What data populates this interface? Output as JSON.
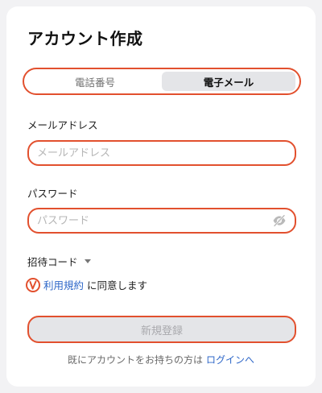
{
  "title": "アカウント作成",
  "tabs": [
    {
      "label": "電話番号",
      "active": false
    },
    {
      "label": "電子メール",
      "active": true
    }
  ],
  "email": {
    "label": "メールアドレス",
    "placeholder": "メールアドレス",
    "value": ""
  },
  "password": {
    "label": "パスワード",
    "placeholder": "パスワード",
    "value": "",
    "toggle_icon": "eye-off-icon"
  },
  "invite": {
    "label": "招待コード",
    "icon": "caret-down-icon"
  },
  "agreement": {
    "checked": false,
    "terms_link": "利用規約",
    "text": "に同意します"
  },
  "register_button": "新規登録",
  "footer": {
    "text": "既にアカウントをお持ちの方は",
    "login_link": "ログインへ"
  },
  "colors": {
    "accent": "#e2502e",
    "link": "#2e67c8",
    "button_bg": "#e4e5e8",
    "button_text": "#a9a9ad"
  }
}
